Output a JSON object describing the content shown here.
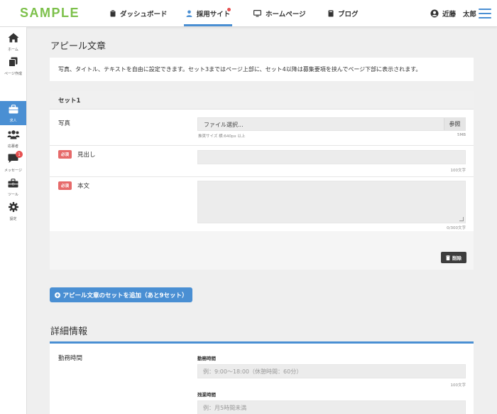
{
  "header": {
    "logo": "SAMPLE",
    "nav": [
      {
        "label": "ダッシュボード",
        "icon": "clipboard-icon"
      },
      {
        "label": "採用サイト",
        "icon": "user-icon",
        "active": true
      },
      {
        "label": "ホームページ",
        "icon": "monitor-icon"
      },
      {
        "label": "ブログ",
        "icon": "book-icon"
      }
    ],
    "user": {
      "last_name": "近藤",
      "first_name": "太郎"
    }
  },
  "sidebar": {
    "items": [
      {
        "label": "ホーム",
        "icon": "home-icon"
      },
      {
        "label": "ページ作成",
        "icon": "copy-icon"
      },
      {
        "label": "求人",
        "icon": "briefcase-icon",
        "active": true
      },
      {
        "label": "応募者",
        "icon": "users-icon"
      },
      {
        "label": "メッセージ",
        "icon": "chat-icon",
        "badge": "1"
      },
      {
        "label": "ツール",
        "icon": "toolbox-icon"
      },
      {
        "label": "設定",
        "icon": "gear-icon"
      }
    ]
  },
  "appeal": {
    "heading": "アピール文章",
    "description": "写真、タイトル、テキストを自由に設定できます。セット3まではページ上部に、セット4以降は募集要項を挟んでページ下部に表示されます。",
    "set": {
      "title": "セット1",
      "photo_label": "写真",
      "file_placeholder": "ファイル選択...",
      "browse_label": "参照",
      "photo_hint": "推奨サイズ 横:640px 以上",
      "photo_limit": "5MB",
      "required_label": "必須",
      "headline_label": "見出し",
      "headline_limit": "100文字",
      "body_label": "本文",
      "body_count": "0/300文字",
      "delete_label": "削除"
    },
    "add_button": "アピール文章のセットを追加（あと9セット）"
  },
  "detail": {
    "heading": "詳細情報",
    "work_hours_label": "勤務時間",
    "work_hours_sublabel": "勤務時間",
    "work_hours_placeholder": "例：9:00〜18:00（休憩時間：60分）",
    "work_hours_limit": "100文字",
    "overtime_sublabel": "残業時間",
    "overtime_placeholder": "例：月5時間未満"
  },
  "colors": {
    "accent": "#4a8fd3",
    "logo": "#7cc04a",
    "required": "#e66a6a",
    "badge": "#e65050"
  }
}
